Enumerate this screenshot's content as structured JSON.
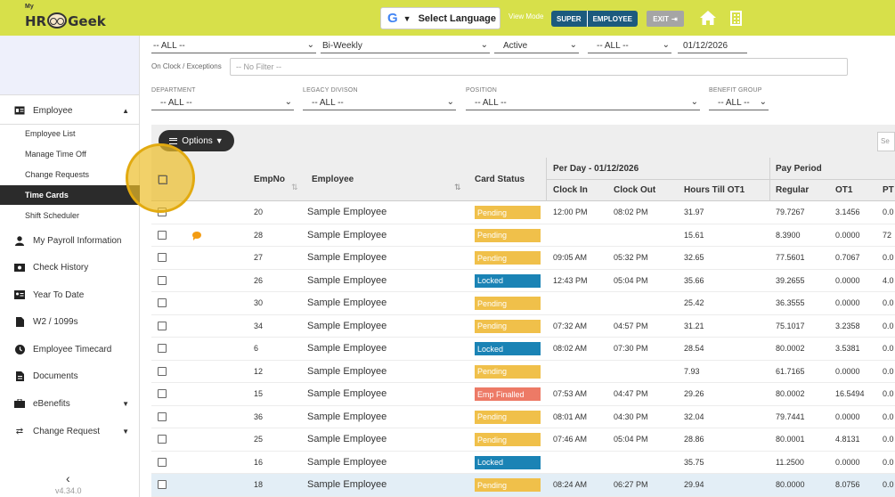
{
  "header": {
    "logo_my": "My",
    "logo_hr": "HR",
    "logo_geek": "Geek",
    "language_label": "Select Language",
    "language_g": "G",
    "view_mode_label": "View Mode",
    "view_mode_options": [
      "SUPER",
      "EMPLOYEE"
    ],
    "exit_label": "EXIT",
    "colors": {
      "topbar": "#d7e04a",
      "segment": "#1c5a7e",
      "exit": "#a5a5a5"
    }
  },
  "sidebar": {
    "items": [
      {
        "label": "Employee",
        "icon": "id-card-icon",
        "caret": "▲"
      },
      {
        "label": "My Payroll Information",
        "icon": "user-icon"
      },
      {
        "label": "Check History",
        "icon": "money-icon"
      },
      {
        "label": "Year To Date",
        "icon": "id-badge-icon"
      },
      {
        "label": "W2 / 1099s",
        "icon": "document-icon"
      },
      {
        "label": "Employee Timecard",
        "icon": "clock-icon"
      },
      {
        "label": "Documents",
        "icon": "file-icon"
      },
      {
        "label": "eBenefits",
        "icon": "briefcase-icon",
        "caret": "▼"
      },
      {
        "label": "Change Request",
        "icon": "exchange-icon",
        "caret": "▼"
      }
    ],
    "sub_items": [
      "Employee List",
      "Manage Time Off",
      "Change Requests",
      "Time Cards",
      "Shift Scheduler"
    ],
    "active_sub_item": "Time Cards",
    "collapse_glyph": "‹",
    "version": "v4.34.0"
  },
  "filters": {
    "row1": {
      "clock_setup": "-- ALL --",
      "pay_schedule": "Bi-Weekly",
      "emp_active_status": "Active",
      "time_card_status": "-- ALL --",
      "today": "01/12/2026"
    },
    "exceptions_label": "On Clock / Exceptions",
    "exceptions_placeholder": "-- No Filter --",
    "row2": [
      {
        "label": "DEPARTMENT",
        "value": "-- ALL --"
      },
      {
        "label": "LEGACY DIVISON",
        "value": "-- ALL --"
      },
      {
        "label": "POSITION",
        "value": "-- ALL --"
      },
      {
        "label": "BENEFIT GROUP",
        "value": "-- ALL --"
      }
    ]
  },
  "toolbar": {
    "options_label": "Options",
    "search_placeholder": "Se"
  },
  "table": {
    "group_per_day": "Per Day - 01/12/2026",
    "group_pay_period": "Pay Period",
    "headers": {
      "empno": "EmpNo",
      "employee": "Employee",
      "card_status": "Card Status",
      "clock_in": "Clock In",
      "clock_out": "Clock Out",
      "hours_till_ot1": "Hours Till OT1",
      "regular": "Regular",
      "ot1": "OT1",
      "pt": "PT"
    },
    "status_colors": {
      "Pending": "#f0c04a",
      "Locked": "#1a83b5",
      "Emp Finalled": "#ed7a66"
    },
    "rows": [
      {
        "empno": "20",
        "employee": "Sample Employee",
        "status": "Pending",
        "clock_in": "12:00 PM",
        "clock_out": "08:02 PM",
        "hours_till_ot1": "31.97",
        "regular": "79.7267",
        "ot1": "3.1456",
        "pt": "0.0",
        "chat": false
      },
      {
        "empno": "28",
        "employee": "Sample Employee",
        "status": "Pending",
        "clock_in": "",
        "clock_out": "",
        "hours_till_ot1": "15.61",
        "regular": "8.3900",
        "ot1": "0.0000",
        "pt": "72",
        "chat": true
      },
      {
        "empno": "27",
        "employee": "Sample Employee",
        "status": "Pending",
        "clock_in": "09:05 AM",
        "clock_out": "05:32 PM",
        "hours_till_ot1": "32.65",
        "regular": "77.5601",
        "ot1": "0.7067",
        "pt": "0.0",
        "chat": false
      },
      {
        "empno": "26",
        "employee": "Sample Employee",
        "status": "Locked",
        "clock_in": "12:43 PM",
        "clock_out": "05:04 PM",
        "hours_till_ot1": "35.66",
        "regular": "39.2655",
        "ot1": "0.0000",
        "pt": "4.0",
        "chat": false
      },
      {
        "empno": "30",
        "employee": "Sample Employee",
        "status": "Pending",
        "clock_in": "",
        "clock_out": "",
        "hours_till_ot1": "25.42",
        "regular": "36.3555",
        "ot1": "0.0000",
        "pt": "0.0",
        "chat": false
      },
      {
        "empno": "34",
        "employee": "Sample Employee",
        "status": "Pending",
        "clock_in": "07:32 AM",
        "clock_out": "04:57 PM",
        "hours_till_ot1": "31.21",
        "regular": "75.1017",
        "ot1": "3.2358",
        "pt": "0.0",
        "chat": false
      },
      {
        "empno": "6",
        "employee": "Sample Employee",
        "status": "Locked",
        "clock_in": "08:02 AM",
        "clock_out": "07:30 PM",
        "hours_till_ot1": "28.54",
        "regular": "80.0002",
        "ot1": "3.5381",
        "pt": "0.0",
        "chat": false
      },
      {
        "empno": "12",
        "employee": "Sample Employee",
        "status": "Pending",
        "clock_in": "",
        "clock_out": "",
        "hours_till_ot1": "7.93",
        "regular": "61.7165",
        "ot1": "0.0000",
        "pt": "0.0",
        "chat": false
      },
      {
        "empno": "15",
        "employee": "Sample Employee",
        "status": "Emp Finalled",
        "clock_in": "07:53 AM",
        "clock_out": "04:47 PM",
        "hours_till_ot1": "29.26",
        "regular": "80.0002",
        "ot1": "16.5494",
        "pt": "0.0",
        "chat": false
      },
      {
        "empno": "36",
        "employee": "Sample Employee",
        "status": "Pending",
        "clock_in": "08:01 AM",
        "clock_out": "04:30 PM",
        "hours_till_ot1": "32.04",
        "regular": "79.7441",
        "ot1": "0.0000",
        "pt": "0.0",
        "chat": false
      },
      {
        "empno": "25",
        "employee": "Sample Employee",
        "status": "Pending",
        "clock_in": "07:46 AM",
        "clock_out": "05:04 PM",
        "hours_till_ot1": "28.86",
        "regular": "80.0001",
        "ot1": "4.8131",
        "pt": "0.0",
        "chat": false
      },
      {
        "empno": "16",
        "employee": "Sample Employee",
        "status": "Locked",
        "clock_in": "",
        "clock_out": "",
        "hours_till_ot1": "35.75",
        "regular": "11.2500",
        "ot1": "0.0000",
        "pt": "0.0",
        "chat": false
      },
      {
        "empno": "18",
        "employee": "Sample Employee",
        "status": "Pending",
        "clock_in": "08:24 AM",
        "clock_out": "06:27 PM",
        "hours_till_ot1": "29.94",
        "regular": "80.0000",
        "ot1": "8.0756",
        "pt": "0.0",
        "chat": false
      }
    ]
  }
}
